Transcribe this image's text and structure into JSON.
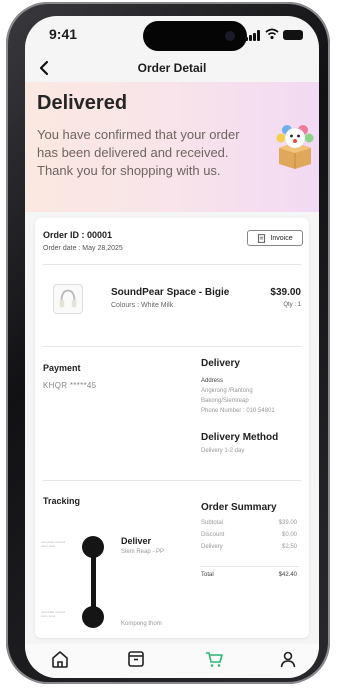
{
  "status_bar": {
    "time": "9:41"
  },
  "nav": {
    "title": "Order Detail"
  },
  "banner": {
    "title": "Delivered",
    "message": "You have confirmed that your order has been delivered and received. Thank you for shopping with us."
  },
  "order": {
    "id_label": "Order ID : 00001",
    "date_label": "Order date : May 28,2025",
    "invoice_label": "Invoice"
  },
  "product": {
    "name": "SoundPear Space - Bigie",
    "colour": "Colours : White Milk",
    "price": "$39.00",
    "qty": "Qty : 1"
  },
  "payment": {
    "title": "Payment",
    "value": "KHQR *****45"
  },
  "delivery": {
    "title": "Delivery",
    "address_label": "Address",
    "address_lines": [
      "Angkrong /Rantong",
      "Bakong/Siemreap",
      "Phone Number : 010 54801"
    ],
    "method_title": "Delivery Method",
    "method_value": "Delivery 1-2 day"
  },
  "tracking": {
    "title": "Tracking",
    "steps": [
      {
        "status": "Deliver",
        "location": "Siem Reap - PP"
      },
      {
        "status": "",
        "location": "Kompong thom"
      }
    ]
  },
  "summary": {
    "title": "Order Summary",
    "rows": [
      {
        "label": "Subtotal",
        "value": "$39.00"
      },
      {
        "label": "Discount",
        "value": "$0.00"
      },
      {
        "label": "Delivery",
        "value": "$2.50"
      }
    ],
    "total_label": "Total",
    "total_value": "$42.40"
  },
  "tabbar": {
    "items": [
      {
        "icon": "home-icon"
      },
      {
        "icon": "archive-box-icon"
      },
      {
        "icon": "cart-icon",
        "active": true
      },
      {
        "icon": "user-icon"
      }
    ],
    "active_color": "#2bb673"
  }
}
